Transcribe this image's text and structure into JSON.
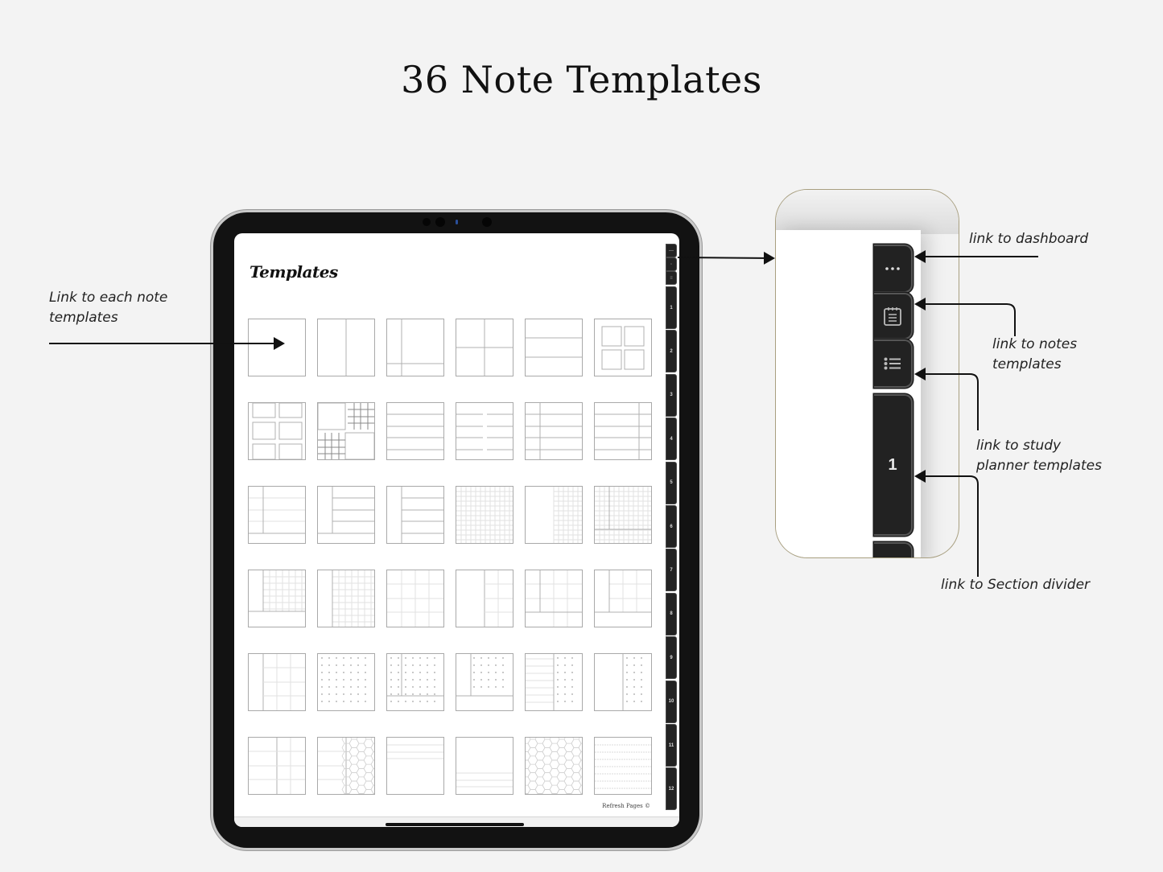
{
  "heading": "36 Note Templates",
  "annotations": {
    "each_template": "Link to each note\ntemplates",
    "dashboard": "link to dashboard",
    "notes_templates": "link to notes\ntemplates",
    "study_planner": "link to study\nplanner templates",
    "section_divider": "link to Section divider"
  },
  "screen": {
    "title": "Templates",
    "copyright": "Refresh Pages ©",
    "templates": [
      "blank",
      "two-column",
      "cornell",
      "quad",
      "three-row",
      "four-boxes",
      "six-boxes",
      "grid-quad",
      "lined",
      "lined-split",
      "lined-margin",
      "lined-right-margin",
      "lined-margin-footer",
      "sidebar-lined-footer",
      "sidebar-lined",
      "grid",
      "half-grid",
      "grid-margin-footer",
      "grid-sidebar-footer",
      "grid-sidebar",
      "large-grid",
      "half-large-grid",
      "large-grid-margin-footer",
      "large-grid-sidebar-footer",
      "large-grid-sidebar",
      "dot",
      "dot-margin-footer",
      "dot-sidebar-footer",
      "lined-dot",
      "half-dot",
      "large-grid-column",
      "lined-hex",
      "top-lined",
      "bottom-lined",
      "hex",
      "dashed-lined"
    ]
  },
  "side_tabs": {
    "icons": [
      "dashboard-icon",
      "notes-icon",
      "list-icon"
    ],
    "sections": [
      "1",
      "2",
      "3",
      "4",
      "5",
      "6",
      "7",
      "8",
      "9",
      "10",
      "11",
      "12"
    ]
  },
  "callout": {
    "icons": [
      "more-dots-icon",
      "notebook-icon",
      "list-icon"
    ],
    "section_label": "1"
  }
}
